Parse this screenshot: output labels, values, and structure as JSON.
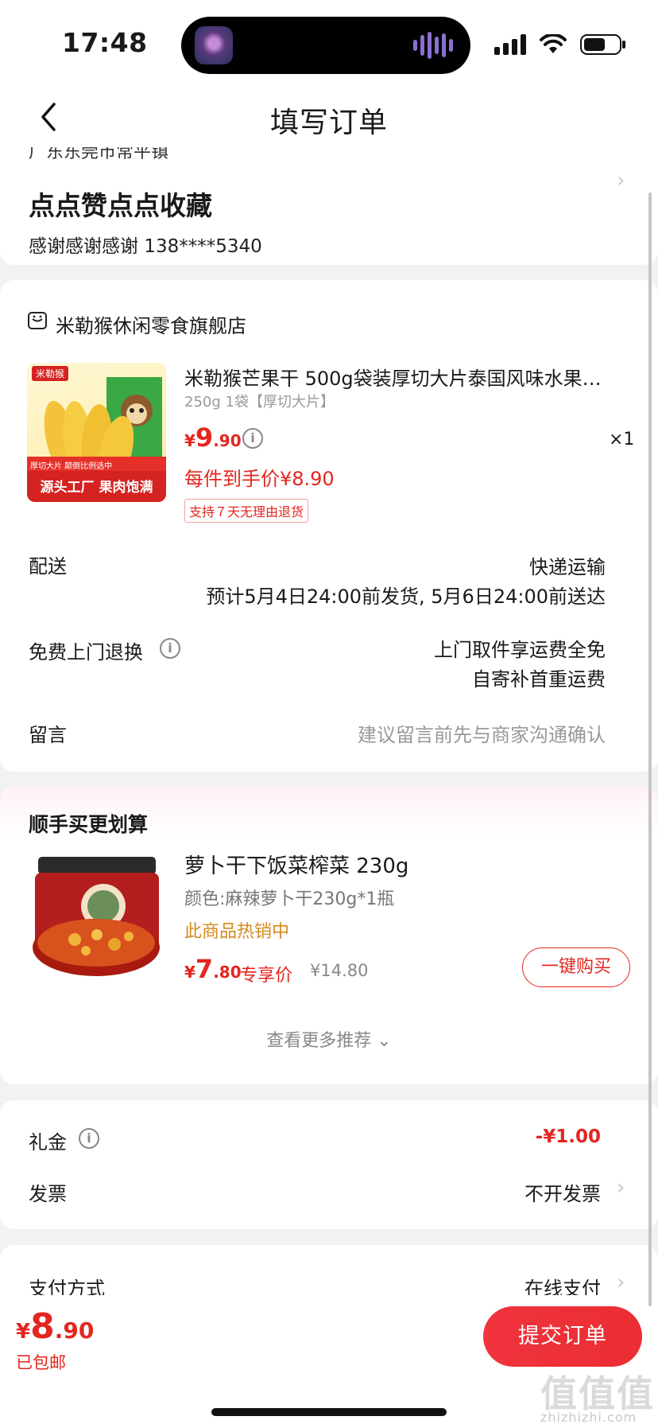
{
  "status_bar": {
    "time": "17:48"
  },
  "nav": {
    "title": "填写订单"
  },
  "address": {
    "partial_line": "广东东莞市常平镇",
    "name": "点点赞点点收藏",
    "contact": "感谢感谢感谢  138****5340"
  },
  "store": {
    "name": "米勒猴休闲零食旗舰店",
    "product": {
      "title": "米勒猴芒果干 500g袋装厚切大片泰国风味水果…",
      "spec": "250g 1袋【厚切大片】",
      "price_currency": "¥",
      "price_int": "9",
      "price_dec": ".90",
      "quantity": "×1",
      "hand_price": "每件到手价¥8.90",
      "return_badge": "支持７天无理由退货",
      "image_brand": "米勒猴",
      "image_tag": "厚切大片 颠倒比例选中",
      "image_banner": "源头工厂 果肉饱满"
    },
    "rows": {
      "delivery_label": "配送",
      "delivery_value": "快递运输",
      "delivery_eta": "预计5月4日24:00前发货, 5月6日24:00前送达",
      "return_label": "免费上门退换",
      "return_value_1": "上门取件享运费全免",
      "return_value_2": "自寄补首重运费",
      "message_label": "留言",
      "message_placeholder": "建议留言前先与商家沟通确认"
    }
  },
  "recommend": {
    "title": "顺手买更划算",
    "item": {
      "title": "萝卜干下饭菜榨菜 230g",
      "spec": "颜色:麻辣萝卜干230g*1瓶",
      "hot": "此商品热销中",
      "price_currency": "¥",
      "price_int": "7",
      "price_dec": ".80",
      "exclusive": "专享价",
      "original": "¥14.80",
      "buy_button": "一键购买"
    },
    "more": "查看更多推荐 ⌄"
  },
  "extras": {
    "gift_label": "礼金",
    "gift_value": "-¥1.00",
    "invoice_label": "发票",
    "invoice_value": "不开发票"
  },
  "payment": {
    "label": "支付方式",
    "value": "在线支付"
  },
  "bottom": {
    "total_currency": "¥",
    "total_int": "8",
    "total_dec": ".90",
    "shipping": "已包邮",
    "submit": "提交订单"
  },
  "watermark": {
    "main": "值值值",
    "sub": "zhizhizhi.com"
  },
  "colors": {
    "accent": "#e3261f",
    "hot": "#d48a1c",
    "background": "#f2f2f4"
  }
}
